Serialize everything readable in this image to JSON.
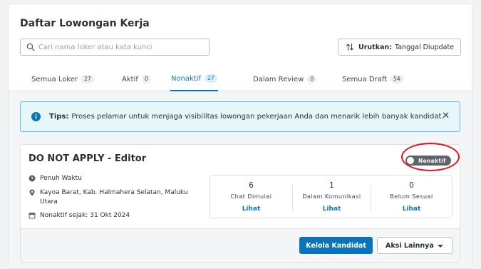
{
  "page": {
    "title": "Daftar Lowongan Kerja"
  },
  "search": {
    "placeholder": "Cari nama loker atau kata kunci",
    "value": ""
  },
  "sort": {
    "label": "Urutkan:",
    "value": "Tanggal Diupdate"
  },
  "tabs": [
    {
      "label": "Semua Loker",
      "count": "27",
      "active": false
    },
    {
      "label": "Aktif",
      "count": "0",
      "active": false
    },
    {
      "label": "Nonaktif",
      "count": "27",
      "active": true
    },
    {
      "label": "Dalam Review",
      "count": "0",
      "active": false
    },
    {
      "label": "Semua Draft",
      "count": "54",
      "active": false
    }
  ],
  "tips": {
    "label": "Tips:",
    "text": "Proses pelamar untuk menjaga visibilitas lowongan pekerjaan Anda dan menarik lebih banyak kandidat.",
    "close_icon": "close-icon"
  },
  "job": {
    "title": "DO NOT APPLY - Editor",
    "status_toggle": "Nonaktif",
    "employment_type": "Penuh Waktu",
    "location": "Kayoa Barat, Kab. Halmahera Selatan, Maluku Utara",
    "inactive_since_label": "Nonaktif sejak:",
    "inactive_since_value": "31 Okt 2024",
    "stats": [
      {
        "value": "6",
        "label": "Chat Dimulai",
        "link": "Lihat"
      },
      {
        "value": "1",
        "label": "Dalam Komunikasi",
        "link": "Lihat"
      },
      {
        "value": "0",
        "label": "Belum Sesuai",
        "link": "Lihat"
      }
    ],
    "primary_action": "Kelola Kandidat",
    "secondary_action": "Aksi Lainnya"
  },
  "colors": {
    "accent": "#0b73b9",
    "toggle_off": "#5f636a",
    "tips_bg": "#e6f7fb",
    "tips_border": "#5cc3de",
    "highlight_ring": "#e3131b"
  }
}
